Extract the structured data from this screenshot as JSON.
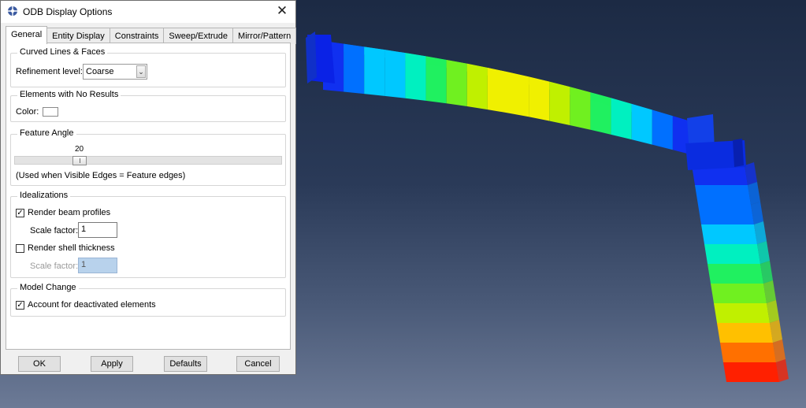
{
  "dialog": {
    "title": "ODB Display Options",
    "close_glyph": "✕"
  },
  "tabs": [
    {
      "label": "General",
      "active": true
    },
    {
      "label": "Entity Display",
      "active": false
    },
    {
      "label": "Constraints",
      "active": false
    },
    {
      "label": "Sweep/Extrude",
      "active": false
    },
    {
      "label": "Mirror/Pattern",
      "active": false
    }
  ],
  "curved": {
    "title": "Curved Lines & Faces",
    "refinement_label": "Refinement level:",
    "refinement_value": "Coarse"
  },
  "no_results": {
    "title": "Elements with No Results",
    "color_label": "Color:",
    "color_value": "#ffffff"
  },
  "feature_angle": {
    "title": "Feature Angle",
    "value": "20",
    "hint": "(Used when Visible Edges = Feature edges)"
  },
  "idealizations": {
    "title": "Idealizations",
    "render_beam_label": "Render beam profiles",
    "render_beam_checked": true,
    "beam_scale_label": "Scale factor:",
    "beam_scale_value": "1",
    "render_shell_label": "Render shell thickness",
    "render_shell_checked": false,
    "shell_scale_label": "Scale factor:",
    "shell_scale_value": "1"
  },
  "model_change": {
    "title": "Model Change",
    "deactivated_label": "Account for deactivated elements",
    "deactivated_checked": true
  },
  "buttons": {
    "ok": "OK",
    "apply": "Apply",
    "defaults": "Defaults",
    "cancel": "Cancel"
  },
  "colors": {
    "contour": [
      "#1030f0",
      "#0070ff",
      "#00c8ff",
      "#00f0c0",
      "#20f060",
      "#70f020",
      "#c0f000",
      "#f0f000",
      "#ffc000",
      "#ff7000",
      "#ff2000"
    ],
    "viewport_top": "#1c2a44",
    "viewport_bottom": "#6c7a96"
  }
}
